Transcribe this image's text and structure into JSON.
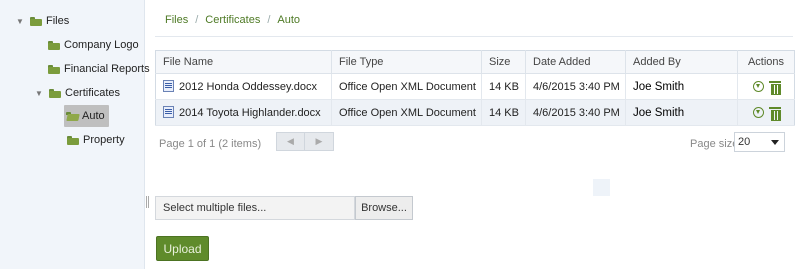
{
  "tree": {
    "root": {
      "label": "Files"
    },
    "children": [
      {
        "label": "Company Logo"
      },
      {
        "label": "Financial Reports"
      },
      {
        "label": "Certificates"
      }
    ],
    "certificates_children": [
      {
        "label": "Auto"
      },
      {
        "label": "Property"
      }
    ]
  },
  "breadcrumb": {
    "items": [
      "Files",
      "Certificates",
      "Auto"
    ],
    "separator": "/"
  },
  "grid": {
    "columns": [
      "File Name",
      "File Type",
      "Size",
      "Date Added",
      "Added By",
      "Actions"
    ],
    "rows": [
      {
        "file_name": "2012 Honda Oddessey.docx",
        "file_type": "Office Open XML Document",
        "size": "14 KB",
        "date_added": "4/6/2015 3:40 PM",
        "added_by": "Joe Smith"
      },
      {
        "file_name": "2014 Toyota Highlander.docx",
        "file_type": "Office Open XML Document",
        "size": "14 KB",
        "date_added": "4/6/2015 3:40 PM",
        "added_by": "Joe Smith"
      }
    ]
  },
  "pager": {
    "info": "Page 1 of 1 (2 items)",
    "page_size_label": "Page size:",
    "page_size_value": "20"
  },
  "upload": {
    "file_input_text": "Select multiple files...",
    "browse_label": "Browse...",
    "upload_label": "Upload"
  },
  "colors": {
    "accent_green": "#5f8b2b",
    "link_green": "#4e7a25",
    "folder_green": "#7b9c3c",
    "sidebar_bg": "#f1f5fa"
  },
  "icons": {
    "tree_folder": "folder-icon",
    "tree_open_folder": "folder-open-icon",
    "file": "word-document-icon",
    "download": "download-circle-icon",
    "delete": "trash-icon"
  }
}
